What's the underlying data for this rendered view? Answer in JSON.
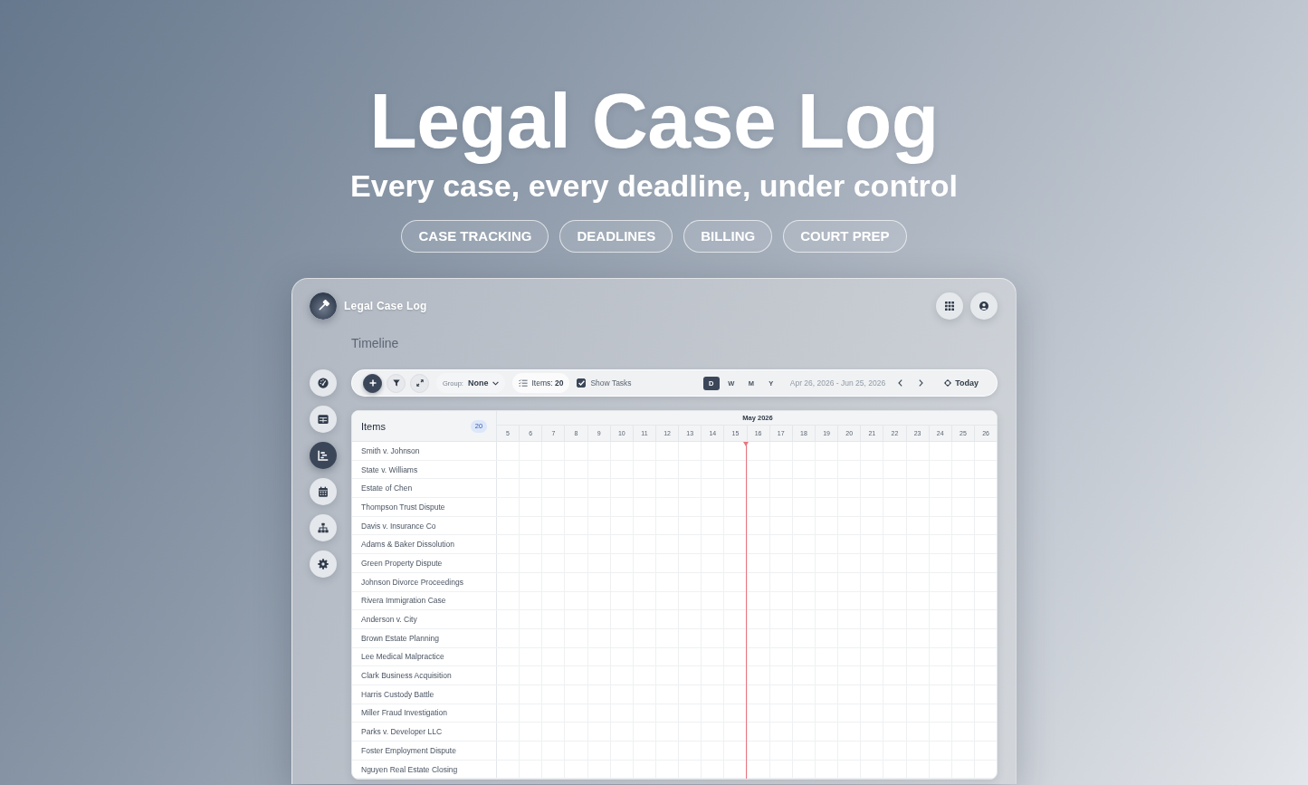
{
  "hero": {
    "title": "Legal Case Log",
    "subtitle": "Every case, every deadline, under control",
    "tags": [
      "CASE TRACKING",
      "DEADLINES",
      "BILLING",
      "COURT PREP"
    ]
  },
  "app": {
    "title": "Legal Case Log",
    "page_title": "Timeline",
    "sidebar": {
      "items": [
        {
          "kind": "gauge",
          "selected": false
        },
        {
          "kind": "table",
          "selected": false
        },
        {
          "kind": "chart",
          "selected": true
        },
        {
          "kind": "calendar",
          "selected": false
        },
        {
          "kind": "hierarchy",
          "selected": false
        },
        {
          "kind": "gear",
          "selected": false
        }
      ]
    },
    "toolbar": {
      "group": {
        "label": "Group:",
        "value": "None"
      },
      "items_chip": "Items: **20**",
      "show_tasks": {
        "label": "Show Tasks",
        "checked": true
      },
      "views": [
        {
          "label": "D",
          "selected": true
        },
        {
          "label": "W",
          "selected": false
        },
        {
          "label": "M",
          "selected": false
        },
        {
          "label": "Y",
          "selected": false
        }
      ],
      "date_range": "Apr 26, 2026 - Jun 25, 2026",
      "today_button": "Today"
    },
    "timeline": {
      "items_heading": "Items",
      "items_count": "20",
      "month": "May 2026",
      "days": [
        {
          "label": "5",
          "today": false
        },
        {
          "label": "6",
          "today": false
        },
        {
          "label": "7",
          "today": false
        },
        {
          "label": "8",
          "today": false
        },
        {
          "label": "9",
          "today": false
        },
        {
          "label": "10",
          "today": false
        },
        {
          "label": "11",
          "today": false
        },
        {
          "label": "12",
          "today": false
        },
        {
          "label": "13",
          "today": false
        },
        {
          "label": "14",
          "today": false
        },
        {
          "label": "15",
          "today": false
        },
        {
          "label": "16",
          "today": true
        },
        {
          "label": "17",
          "today": false
        },
        {
          "label": "18",
          "today": false
        },
        {
          "label": "19",
          "today": false
        },
        {
          "label": "20",
          "today": false
        },
        {
          "label": "21",
          "today": false
        },
        {
          "label": "22",
          "today": false
        },
        {
          "label": "23",
          "today": false
        },
        {
          "label": "24",
          "today": false
        },
        {
          "label": "25",
          "today": false
        },
        {
          "label": "26",
          "today": false
        }
      ],
      "rows": [
        "Smith v. Johnson",
        "State v. Williams",
        "Estate of Chen",
        "Thompson Trust Dispute",
        "Davis v. Insurance Co",
        "Adams & Baker Dissolution",
        "Green Property Dispute",
        "Johnson Divorce Proceedings",
        "Rivera Immigration Case",
        "Anderson v. City",
        "Brown Estate Planning",
        "Lee Medical Malpractice",
        "Clark Business Acquisition",
        "Harris Custody Battle",
        "Miller Fraud Investigation",
        "Parks v. Developer LLC",
        "Foster Employment Dispute",
        "Nguyen Real Estate Closing"
      ]
    }
  }
}
